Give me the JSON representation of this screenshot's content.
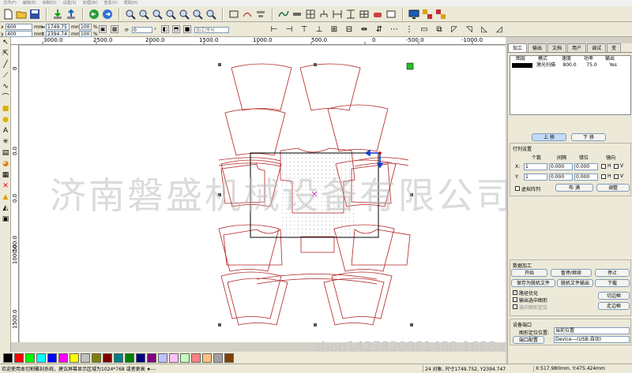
{
  "menu": [
    "文件(F)",
    "编辑(E)",
    "绘制(D)",
    "设置(S)",
    "处理(W)",
    "查看(V)",
    "帮助(H)"
  ],
  "toolbar2": {
    "x_value": "600",
    "y_value": "400",
    "unit_mm": "mm",
    "w_value": "1749.75",
    "h_value": "2394.74",
    "w_unit": "mm",
    "h_unit": "mm",
    "sx_value": "100",
    "sy_value": "100",
    "pct": "%",
    "angle_value": "0",
    "deg": "°",
    "layer_placeholder": "加工序号"
  },
  "ruler_top": [
    "3000.0",
    "2500.0",
    "2000.0",
    "1500.0",
    "1000.0",
    "500.0",
    "0",
    "-500.0",
    "-1000.0"
  ],
  "ruler_left": [
    "0",
    "0.0",
    "0.0",
    "500.0",
    "1000.0",
    "1500.0"
  ],
  "watermark": "济南磐盛机械设备有限公司",
  "watermark_shop": "shop1427820981480.1688.com",
  "colors": {
    "outline": "#b22222",
    "selection": "#000000",
    "handle": "#555555",
    "palette": [
      "#000000",
      "#ff0000",
      "#00ff00",
      "#00ffff",
      "#0000ff",
      "#ff00ff",
      "#ffff00",
      "#c0c0c0",
      "#808000",
      "#800000",
      "#008080",
      "#008000",
      "#000080",
      "#800080",
      "#c0c0ff",
      "#ffc0ff",
      "#c0ffc0",
      "#ff8080",
      "#ffc080",
      "#a0a0a0",
      "#804000"
    ]
  },
  "right_panel": {
    "tabs": [
      "加工",
      "输出",
      "文档",
      "用户",
      "调试",
      "变"
    ],
    "layer_table": {
      "headers": [
        "图层",
        "模式",
        "速度",
        "功率",
        "输出"
      ],
      "rows": [
        [
          "",
          "激光扫描",
          "800.0",
          "75.0",
          "Yes"
        ]
      ]
    },
    "move_up": "上 移",
    "move_down": "下 移",
    "array_title": "行列设置",
    "array_headers": [
      "个数",
      "间隔",
      "错位",
      "镜向"
    ],
    "array_x_label": "X:",
    "array_y_label": "Y:",
    "array_x": [
      "1",
      "0.000",
      "0.000"
    ],
    "array_y": [
      "1",
      "0.000",
      "0.000"
    ],
    "mirror_h": "H",
    "mirror_v": "V",
    "virtual_array": "虚拟阵列",
    "layout_btn": "布 满",
    "adjust_btn": "调整",
    "process_title": "数据加工",
    "start": "开始",
    "pause": "暂停/继续",
    "stop": "停止",
    "save_offline": "保存为脱机文件",
    "offline_output": "脱机文件输出",
    "download": "下载",
    "path_opt": "路径优化",
    "output_selected": "输出选中图形",
    "selected_locate": "选中图形定位",
    "cut_frame": "切边框",
    "walk_frame": "走边框",
    "device_title": "设备端口",
    "origin_label": "图形定位位置:",
    "origin_value": "当前位置",
    "port_label": "端口配置",
    "port_value": "Device---(USB:自动)"
  },
  "status": {
    "message": "欢迎使用本切割雕刻系统，建议屏幕显示区域为1024*768 或者更高 ★---",
    "objects": "24 对象, 尺寸1749.752, Y2394.747",
    "cursor": "X:517.980mm, Y:475.424mm"
  }
}
